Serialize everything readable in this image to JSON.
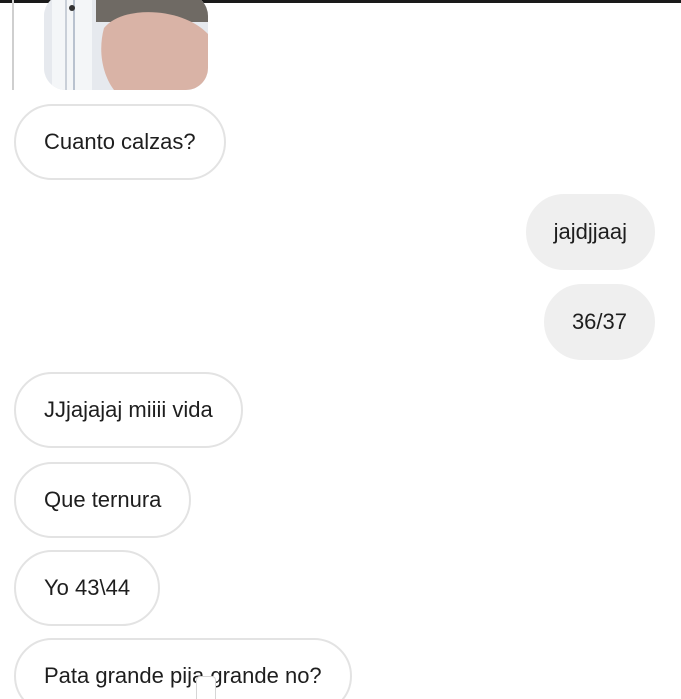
{
  "messages": [
    {
      "side": "incoming",
      "text": "Cuanto calzas?"
    },
    {
      "side": "outgoing",
      "text": "jajdjjaaj"
    },
    {
      "side": "outgoing",
      "text": "36/37"
    },
    {
      "side": "incoming",
      "text": "JJjajajaj miiii vida"
    },
    {
      "side": "incoming",
      "text": "Que ternura"
    },
    {
      "side": "incoming",
      "text": "Yo 43\\44"
    },
    {
      "side": "incoming",
      "text": "Pata grande pija grande no?"
    }
  ],
  "colors": {
    "incoming_bubble": "#ffffff",
    "incoming_border": "#e3e3e3",
    "outgoing_bubble": "#efefef",
    "text": "#1e1e1e"
  },
  "icons": {
    "photo": "shared-photo-thumbnail"
  }
}
